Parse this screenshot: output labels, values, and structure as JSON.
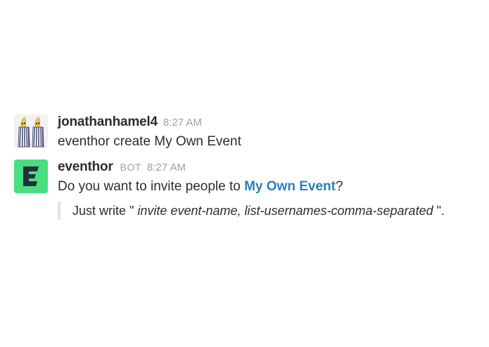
{
  "messages": [
    {
      "username": "jonathanhamel4",
      "timestamp": "8:27 AM",
      "text": "eventhor create My Own Event",
      "avatar_icon": "bananas-in-pyjamas-avatar"
    },
    {
      "username": "eventhor",
      "badge": "BOT",
      "timestamp": "8:27 AM",
      "text_before": "Do you want to invite people to ",
      "link_text": "My Own Event",
      "text_after": "?",
      "avatar_icon": "eventhor-logo-icon",
      "attachment": {
        "prefix": "Just write \" ",
        "command": "invite event-name, list-usernames-comma-separated",
        "suffix": " \"."
      }
    }
  ],
  "colors": {
    "link": "#2a80b9",
    "bot_avatar_bg": "#4ade80",
    "muted_text": "#9e9ea6"
  }
}
